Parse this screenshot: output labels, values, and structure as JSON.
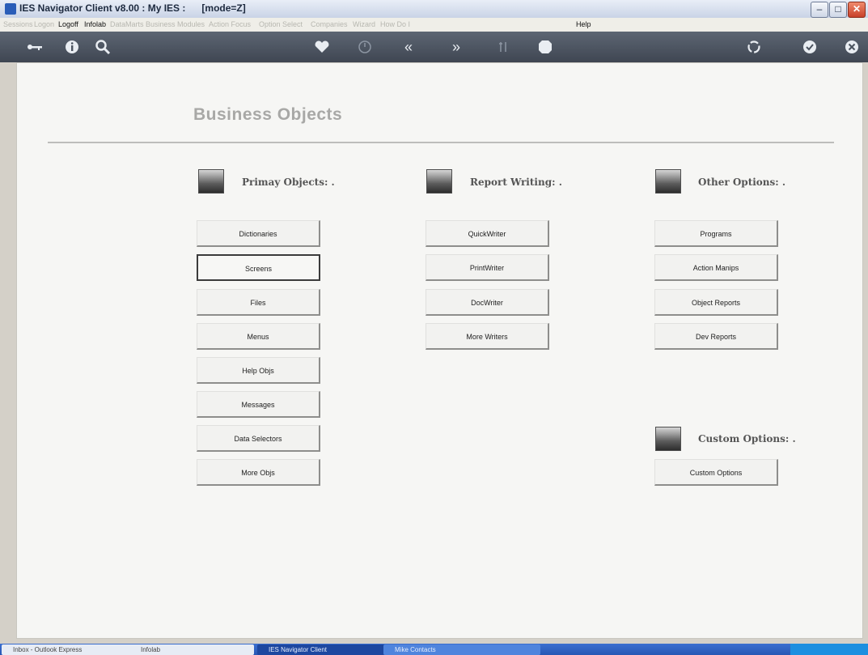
{
  "window": {
    "title": "IES Navigator Client v8.00 : My IES :      [mode=Z]",
    "controls": [
      "minimize",
      "maximize",
      "close"
    ]
  },
  "menubar": {
    "items": [
      {
        "label": "Sessions",
        "enabled": false
      },
      {
        "label": "Logon",
        "enabled": false
      },
      {
        "label": "Logoff",
        "enabled": true
      },
      {
        "label": "Infolab",
        "enabled": true
      },
      {
        "label": "DataMarts",
        "enabled": false
      },
      {
        "label": "Business Modules",
        "enabled": false
      },
      {
        "label": "Action Focus",
        "enabled": false
      },
      {
        "label": "Option Select",
        "enabled": false
      },
      {
        "label": "Companies",
        "enabled": false
      },
      {
        "label": "Wizard",
        "enabled": false
      },
      {
        "label": "How Do I",
        "enabled": false
      },
      {
        "label": "Help",
        "enabled": true
      }
    ]
  },
  "toolbar": {
    "icons": [
      "key-icon",
      "info-icon",
      "search-icon",
      "heart-icon",
      "clock-icon",
      "rewind-icon",
      "forward-icon",
      "sort-icon",
      "stop-icon",
      "recycle-icon",
      "check-icon",
      "close-icon"
    ]
  },
  "page": {
    "title": "Business Objects",
    "sections": {
      "primary": {
        "title": "Primay Objects: .",
        "buttons": [
          "Dictionaries",
          "Screens",
          "Files",
          "Menus",
          "Help Objs",
          "Messages",
          "Data Selectors",
          "More Objs"
        ]
      },
      "report": {
        "title": "Report Writing: .",
        "buttons": [
          "QuickWriter",
          "PrintWriter",
          "DocWriter",
          "More Writers"
        ]
      },
      "other": {
        "title": "Other Options: .",
        "buttons": [
          "Programs",
          "Action Manips",
          "Object Reports",
          "Dev Reports"
        ]
      },
      "custom": {
        "title": "Custom Options: .",
        "buttons": [
          "Custom Options"
        ]
      }
    },
    "selected_button": "Screens"
  },
  "taskbar": {
    "items": [
      "Inbox - Outlook Express",
      "Infolab",
      "IES Navigator Client",
      "Mike Contacts"
    ]
  }
}
